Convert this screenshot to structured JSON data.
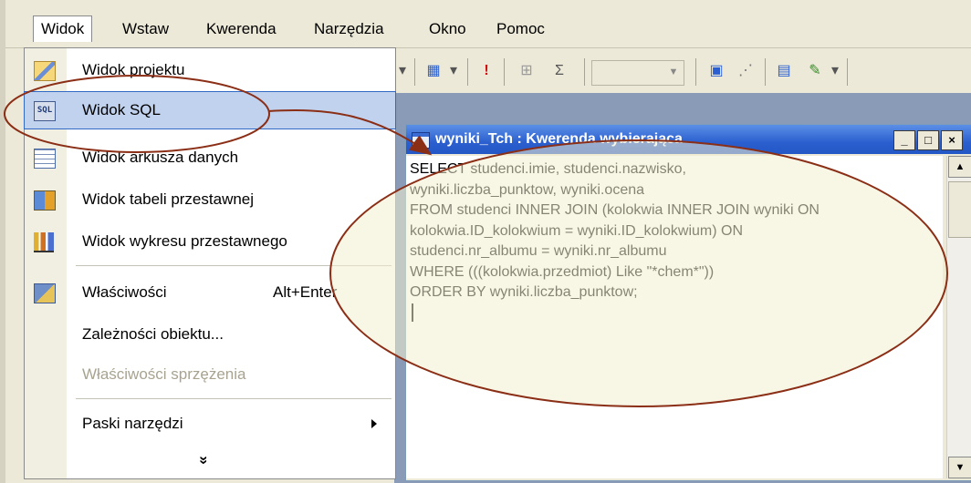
{
  "menubar": {
    "items": [
      {
        "label": "Widok",
        "active": true
      },
      {
        "label": "Wstaw"
      },
      {
        "label": "Kwerenda"
      },
      {
        "label": "Narzędzia"
      },
      {
        "label": "Okno"
      },
      {
        "label": "Pomoc"
      }
    ]
  },
  "dropdown": {
    "items": [
      {
        "label": "Widok projektu",
        "icon": "design-view-icon"
      },
      {
        "label": "Widok SQL",
        "icon": "sql-view-icon",
        "highlighted": true
      },
      {
        "label": "Widok arkusza danych",
        "icon": "datasheet-view-icon"
      },
      {
        "label": "Widok tabeli przestawnej",
        "icon": "pivot-table-icon"
      },
      {
        "label": "Widok wykresu przestawnego",
        "icon": "pivot-chart-icon"
      },
      {
        "label": "Właściwości",
        "shortcut": "Alt+Enter",
        "icon": "properties-icon"
      },
      {
        "label": "Zależności obiektu..."
      },
      {
        "label": "Właściwości sprzężenia",
        "disabled": true
      },
      {
        "label": "Paski narzędzi",
        "submenu": true
      }
    ],
    "more_glyph": "»"
  },
  "toolbar": {
    "sigma": "Σ",
    "exclam": "!"
  },
  "query_window": {
    "title": "wyniki_Tch : Kwerenda wybierająca",
    "min": "_",
    "max": "□",
    "close": "×",
    "sql_lines": [
      "SELECT studenci.imie, studenci.nazwisko,",
      "wyniki.liczba_punktow, wyniki.ocena",
      "FROM studenci INNER JOIN (kolokwia INNER JOIN wyniki ON",
      "kolokwia.ID_kolokwium = wyniki.ID_kolokwium) ON",
      "studenci.nr_albumu = wyniki.nr_albumu",
      "WHERE (((kolokwia.przedmiot) Like \"*chem*\"))",
      "ORDER BY wyniki.liczba_punktow;"
    ]
  },
  "colors": {
    "highlight": "#c1d2ee",
    "title_bar": "#2b5fcf",
    "annotation": "#8b2e16",
    "annotation_fill": "#f3efcf"
  }
}
